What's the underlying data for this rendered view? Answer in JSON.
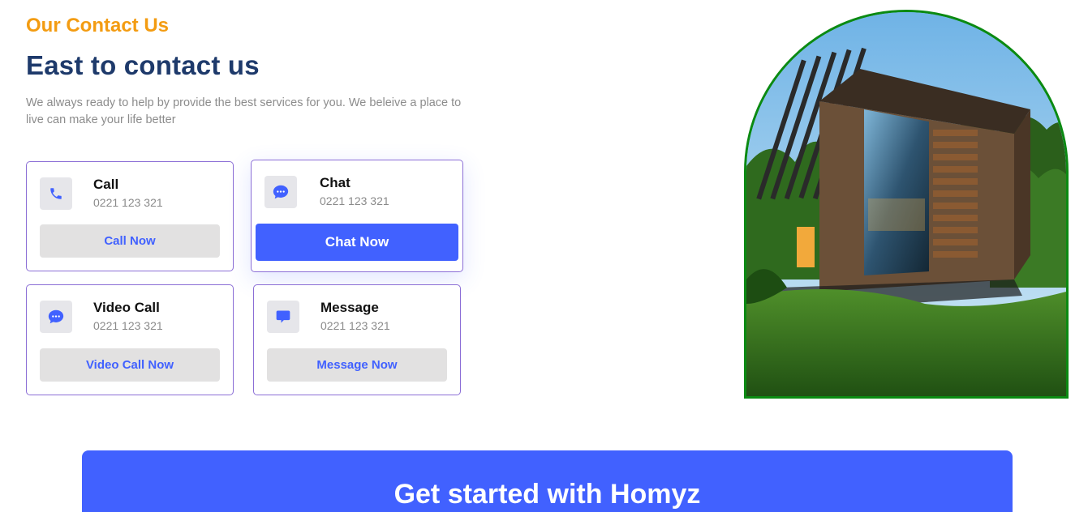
{
  "section": {
    "eyebrow": "Our Contact Us",
    "headline": "East to contact us",
    "description": "We always ready to help by provide the best services for you. We beleive a place to live can make your life better"
  },
  "cards": [
    {
      "title": "Call",
      "number": "0221 123 321",
      "button": "Call Now",
      "icon": "phone-icon"
    },
    {
      "title": "Chat",
      "number": "0221 123 321",
      "button": "Chat Now",
      "icon": "chat-bubble-icon"
    },
    {
      "title": "Video Call",
      "number": "0221 123 321",
      "button": "Video Call Now",
      "icon": "video-chat-icon"
    },
    {
      "title": "Message",
      "number": "0221 123 321",
      "button": "Message Now",
      "icon": "message-icon"
    }
  ],
  "image": {
    "subject": "modern glass and wood house in greenery"
  },
  "cta": {
    "title": "Get started with Homyz"
  },
  "colors": {
    "accent_orange": "#f39c12",
    "heading_navy": "#1e3a6b",
    "primary_blue": "#4161ff",
    "card_border": "#8b6ed6",
    "image_border": "#0b8a12"
  }
}
